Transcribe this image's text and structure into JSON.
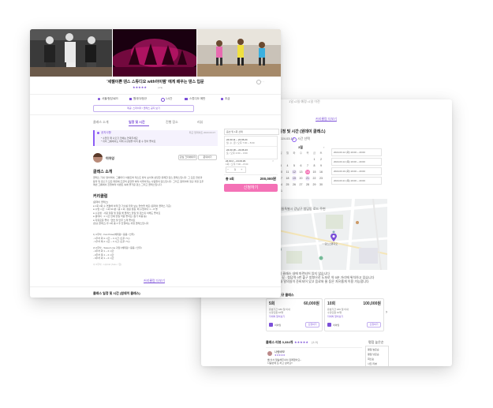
{
  "front": {
    "title": "'세젤이쁜 댄스 스튜디오 with아이템' 에게 배우는 댄스 입문",
    "rating": "★★★★★",
    "rating_text": "(4.9)",
    "chips": [
      "서울/청담/로드",
      "원데이/정규",
      "1시간",
      "스튜디오 에반",
      "초급"
    ],
    "notice_btn": "제공: 스파이더 / 클래스 공지 보기",
    "tabs": [
      "클래스 소개",
      "일정 및 시간",
      "진행 장소",
      "리뷰"
    ],
    "alert": {
      "label": "공지사항",
      "date": "최근 업데이트 2023.03.07",
      "line1": "* 수업할 때 나오기 전에는 연락주세요",
      "line2": "* 취미 그룹에서도 미래 수강생을 미리 뵙 수 있어 좋아요"
    },
    "host": {
      "name": "이아잉",
      "follow": "관심 크리에이터",
      "share": "문의하기"
    },
    "intro_title": "클래스 소개",
    "intro_lines": [
      "클래스 기획: 영어해서, 그룹마다 이벤트와 테스트 방식 보이며 상당한 유쾌한 댄스 클래스입니다. 그 모든 연습과",
      "동작 및 댄스가 모든 화면에 조금씩 공연을 하며 이루어지는 사람들의 댄스입니다. 그리고 원데이와 정규 과정 모두",
      "매번 그룹에서 진행하며 이벤트 속에 즐거운 댄스 그리고 클래스입니다."
    ],
    "curriculum_title": "커리큘럼",
    "curriculum_lines": [
      "[원데이 클래스]",
      "● 1회 3회 수 연결해 하게 한 가사를 따라 보는 연습을 해요 (원데이 클래스 기준)",
      "● 수업 시간 : 1회 90 분 / 총 1 회, 정원 정원, 매 수업마다 1 ~ 8 명",
      "● 수강생 : 사람 정원 및 정원 해 클래스 당일 및 댄스의 이해도 좋아요",
      "● 원데이 : 1 시간 안에 당일 학원 좋아요 (참가 비용 등)",
      "● 자유로운 좋아 : 연습 및 안무 노래 좋아요",
      "[정규 클래스] 주 1회 총 4 주 진행하는 과정 클래스입니다"
    ],
    "schedule_lines": [
      "1) 1주차 - Fan Pose(베테랑 / 응용 / 안무)",
      "- 1주차 화 2 시간 ~ 3 시간 (오후 7시)",
      "- 1주차 목 2 시간 ~ 3 시간 (오후 7시)",
      "2) 2주차 - Sweet Line 과정 (베테랑 / 응용 / 안무)",
      "- 2주차 화 1 ~ 2 시간",
      "- 2주차 목 1 ~ 2 시간",
      "- 3주차 화 1 ~ 2 시간",
      "3) 3주차 - Hybrid (Solo / 합)"
    ],
    "more_link": "커리큘럼 더보기",
    "bottom_title": "클래스 일정 및 시간 (원데이 클래스)",
    "sidebar": {
      "header": "옵션 및 1회 선택",
      "opt1": "24.03.11 ~ 24.06.24",
      "opt1b": "월, 수, 금 / 오후 7:00 ~ 8:00",
      "opt2": "24.03.18 ~ 24.06.23",
      "opt2b": "토 / 오후 2:00 ~ 3:00",
      "qty_label": "24.03.2 ~ 24.03.29",
      "qty_note": "1회 / 오후 7:00 ~ 8:00",
      "qty": "1",
      "total_label": "총 5회",
      "total_price": "200,000원",
      "cta": "신청하기"
    }
  },
  "back": {
    "top_meta": "1일   •2일 예정   •1일 이전",
    "top_link": "커리큘럼 더보기",
    "section_title": "일정 및 시간 (원데이 클래스)",
    "date_tab": "2024.03.14",
    "time_tab": "시간 선택",
    "month": "3월",
    "weekdays": [
      "일",
      "월",
      "화",
      "수",
      "목",
      "금",
      "토"
    ],
    "days": [
      "",
      "",
      "",
      "",
      "",
      "1",
      "2",
      "3",
      "4",
      "5",
      "6",
      "7",
      "8",
      "9",
      "10",
      "11",
      "12",
      "13",
      "14",
      "15",
      "16",
      "17",
      "18",
      "19",
      "20",
      "21",
      "22",
      "23",
      "24",
      "25",
      "26",
      "27",
      "28",
      "29",
      "30",
      "31"
    ],
    "slots": [
      "2024.03.12 (화) 19:00 ~ 20:00",
      "2024.03.14 (목) 19:00 ~ 20:00",
      "2024.03.19 (화) 19:00 ~ 20:00",
      "2024.03.21 (목) 19:00 ~ 20:00"
    ],
    "place_title": "진행 장소",
    "address_line": "서울특별시 강남구 청담동 로드 주변",
    "map_pin_label": "○○댄스스튜디오",
    "desc_lines": [
      "* 주차 공간이 클래스 내에 마련되어 있지 않습니다",
      "* 찾아오시는 길 : 청담역 9번 출구 방향으로 도보로 약 5분 거리에 위치하고 있습니다",
      "* 강의 공간 내 탈의실이 준비되어 있고 음료와 물 등은 자유롭게 이용 가능합니다"
    ],
    "package_title": "정규 클래스",
    "packages": [
      {
        "count": "5회",
        "price": "60,000원",
        "l1": "유효기간 180 일 이내",
        "l2": "수강인원 10명",
        "link": "자세히 알아보기",
        "host": "이아잉",
        "btn": "신청하기"
      },
      {
        "count": "10회",
        "price": "100,000원",
        "l1": "유효기간 180 일 이내",
        "l2": "수강인원 10명",
        "link": "자세히 알아보기",
        "host": "이아잉",
        "btn": "신청하기"
      }
    ],
    "review_title": "클래스 리뷰 3,334개",
    "review_rating": "★★★★★",
    "review_score": "(4.9)",
    "sort_label": "평점 높은순",
    "sort_options": [
      "평점 높은순",
      "평점 낮은순",
      "최신순",
      "사진 리뷰"
    ],
    "review": {
      "name": "나랑바보",
      "stars": "★★★★★",
      "l1": "쌤 아서 말씀해주셔서 유쾌했어요~",
      "l2": "다음번에 또 하고 싶어요!!"
    }
  },
  "colors": {
    "accent": "#8b5cf6",
    "pink": "#f472b6",
    "star": "#7b4fd8"
  }
}
